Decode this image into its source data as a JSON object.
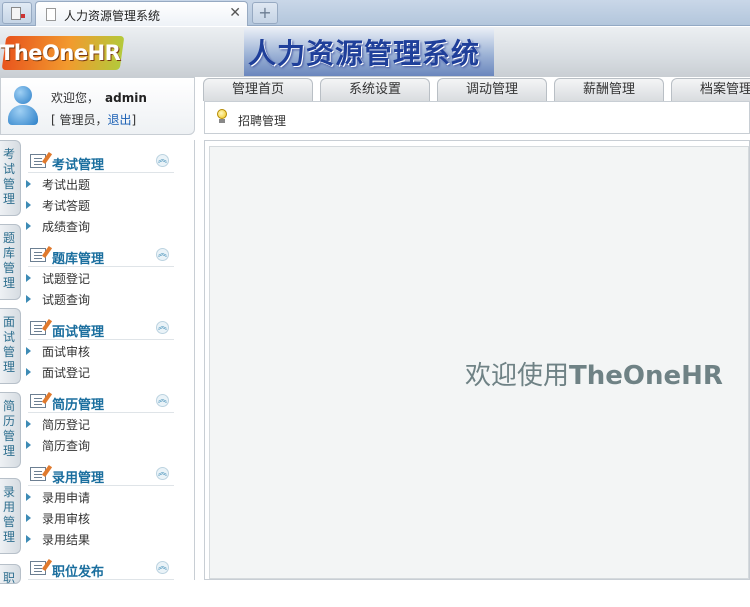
{
  "browser": {
    "tab_title": "人力资源管理系统",
    "close_glyph": "✕",
    "new_tab_glyph": "+"
  },
  "header": {
    "logo_text": "TheOneHR",
    "system_title": "人力资源管理系统"
  },
  "user": {
    "greeting": "欢迎您，",
    "username": "admin",
    "role_open": "[ 管理员，",
    "logout": "退出",
    "role_close": "]"
  },
  "nav": {
    "tabs": [
      {
        "label": "管理首页"
      },
      {
        "label": "系统设置"
      },
      {
        "label": "调动管理"
      },
      {
        "label": "薪酬管理"
      },
      {
        "label": "档案管理"
      }
    ],
    "current_section": "招聘管理"
  },
  "sidebar": {
    "vertical_tabs": [
      {
        "label": "考试管理"
      },
      {
        "label": "题库管理"
      },
      {
        "label": "面试管理"
      },
      {
        "label": "简历管理"
      },
      {
        "label": "录用管理"
      },
      {
        "label": "职"
      }
    ],
    "groups": [
      {
        "title": "考试管理",
        "items": [
          "考试出题",
          "考试答题",
          "成绩查询"
        ]
      },
      {
        "title": "题库管理",
        "items": [
          "试题登记",
          "试题查询"
        ]
      },
      {
        "title": "面试管理",
        "items": [
          "面试审核",
          "面试登记"
        ]
      },
      {
        "title": "简历管理",
        "items": [
          "简历登记",
          "简历查询"
        ]
      },
      {
        "title": "录用管理",
        "items": [
          "录用申请",
          "录用审核",
          "录用结果"
        ]
      },
      {
        "title": "职位发布",
        "items": []
      }
    ],
    "collapse_glyph": "︽"
  },
  "main": {
    "welcome_prefix": "欢迎使用",
    "welcome_brand": "TheOneHR"
  },
  "icons": {
    "app": "document-icon",
    "user": "user-avatar-icon",
    "hint": "lightbulb-icon",
    "group": "notepad-edit-icon",
    "item": "arrow-right-icon",
    "collapse": "double-chevron-up-icon"
  },
  "colors": {
    "accent": "#1a6e9e",
    "link": "#1a5fb4",
    "welcome_text": "#6f8285"
  }
}
